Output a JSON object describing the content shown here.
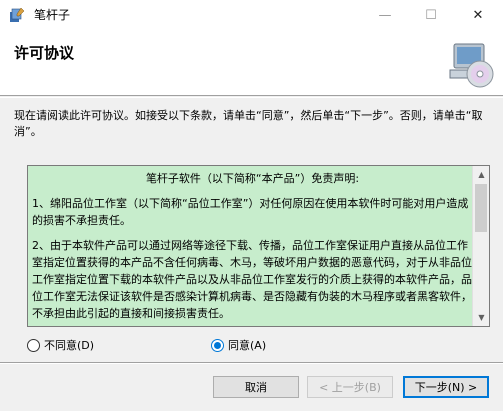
{
  "window": {
    "title": "笔杆子",
    "minimize_glyph": "—",
    "maximize_glyph": "☐",
    "close_glyph": "✕"
  },
  "banner": {
    "title": "许可协议",
    "graphic": "computer-cd-icon"
  },
  "instruction": "现在请阅读此许可协议。如接受以下条款，请单击“同意”，然后单击“下一步”。否则，请单击“取消”。",
  "license": {
    "heading": "笔杆子软件（以下简称“本产品”）免责声明:",
    "paragraphs": [
      "1、绵阳品位工作室（以下简称“品位工作室”）对任何原因在使用本软件时可能对用户造成的损害不承担责任。",
      "2、由于本软件产品可以通过网络等途径下载、传播，品位工作室保证用户直接从品位工作室指定位置获得的本产品不含任何病毒、木马，等破坏用户数据的恶意代码，对于从非品位工作室指定位置下载的本软件产品以及从非品位工作室发行的介质上获得的本软件产品，品位工作室无法保证该软件是否感染计算机病毒、是否隐藏有伪装的木马程序或者黑客软件，不承担由此引起的直接和间接损害责任。"
    ]
  },
  "radios": {
    "disagree_label": "不同意(D)",
    "agree_label": "同意(A)",
    "selected": "agree"
  },
  "buttons": {
    "cancel": "取消",
    "back": "< 上一步(B)",
    "next": "下一步(N) >"
  },
  "colors": {
    "license_bg": "#c7edcc",
    "accent": "#0078d7"
  }
}
